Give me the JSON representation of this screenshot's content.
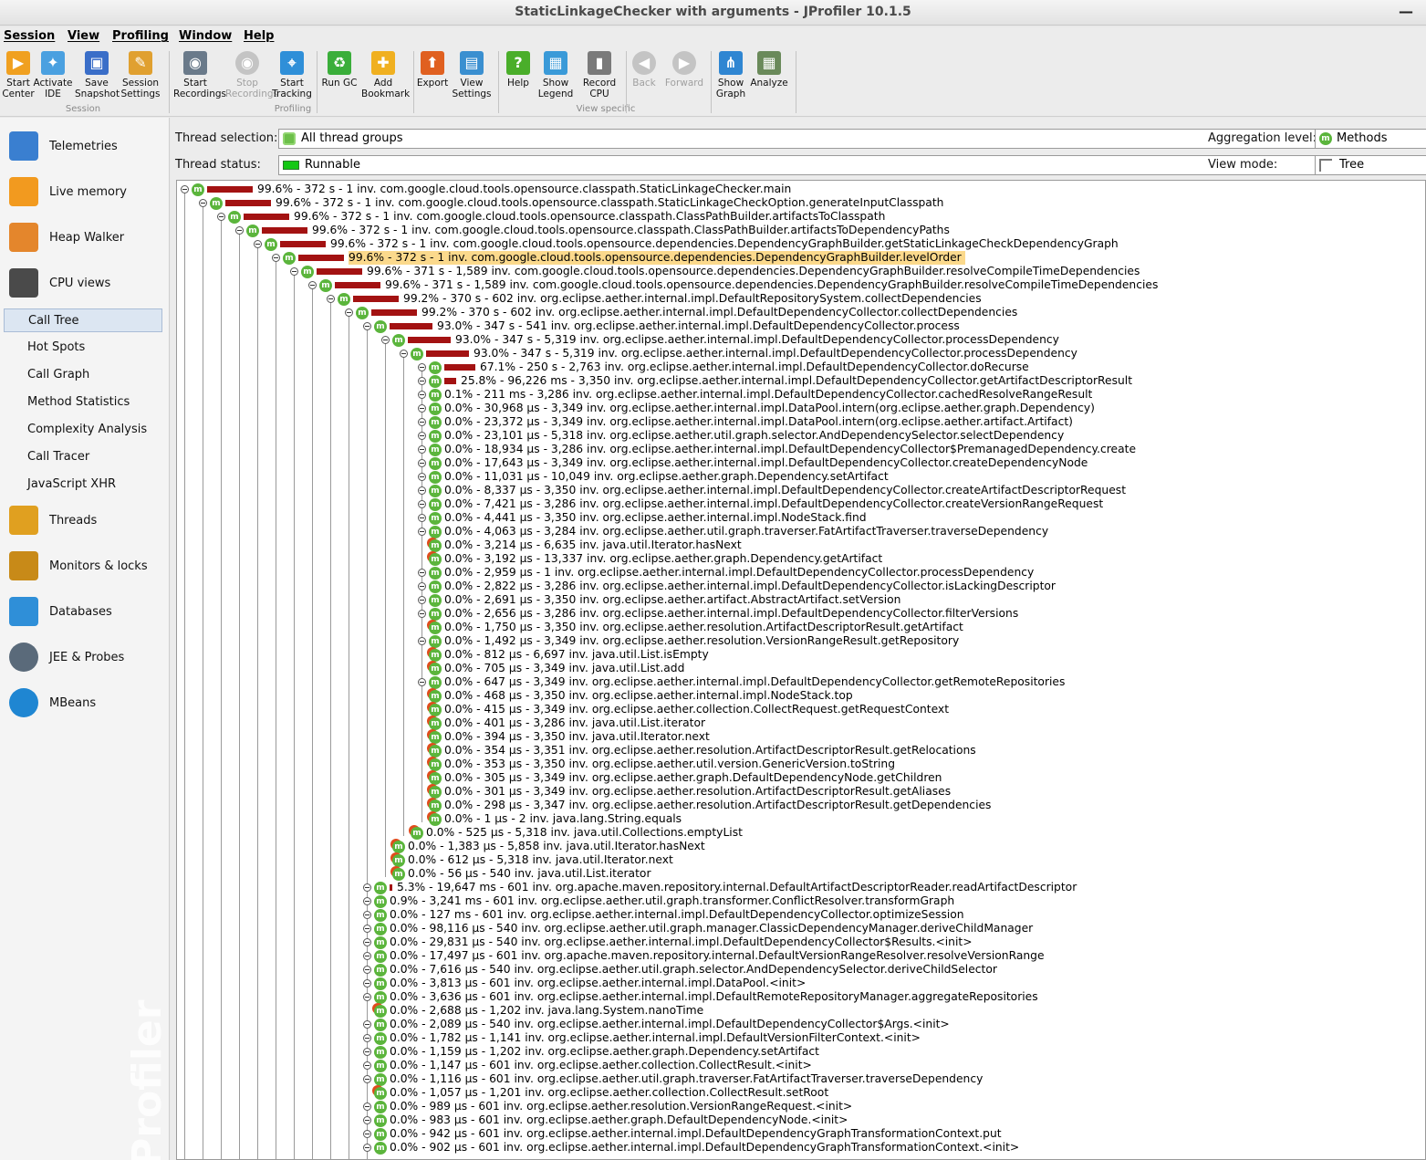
{
  "window": {
    "title": "StaticLinkageChecker with arguments - JProfiler 10.1.5",
    "minimize_glyph": "—"
  },
  "menu": [
    "Session",
    "View",
    "Profiling",
    "Window",
    "Help"
  ],
  "toolbar": {
    "buttons": [
      {
        "label": "Start\nCenter",
        "icon": "start-center-icon",
        "disabled": false
      },
      {
        "label": "Activate\nIDE",
        "icon": "activate-ide-icon",
        "disabled": false
      },
      {
        "label": "Save\nSnapshot",
        "icon": "save-snapshot-icon",
        "disabled": false
      },
      {
        "label": "Session\nSettings",
        "icon": "session-settings-icon",
        "disabled": false
      },
      {
        "label": "Start\nRecordings",
        "icon": "start-recordings-icon",
        "disabled": false
      },
      {
        "label": "Stop\nRecordings",
        "icon": "stop-recordings-icon",
        "disabled": true
      },
      {
        "label": "Start\nTracking",
        "icon": "start-tracking-icon",
        "disabled": false
      },
      {
        "label": "Run GC",
        "icon": "run-gc-icon",
        "disabled": false
      },
      {
        "label": "Add\nBookmark",
        "icon": "add-bookmark-icon",
        "disabled": false
      },
      {
        "label": "Export",
        "icon": "export-icon",
        "disabled": false
      },
      {
        "label": "View\nSettings",
        "icon": "view-settings-icon",
        "disabled": false
      },
      {
        "label": "Help",
        "icon": "help-icon",
        "disabled": false
      },
      {
        "label": "Show\nLegend",
        "icon": "show-legend-icon",
        "disabled": false
      },
      {
        "label": "Record\nCPU",
        "icon": "record-cpu-icon",
        "disabled": false
      },
      {
        "label": "Back",
        "icon": "back-icon",
        "disabled": true
      },
      {
        "label": "Forward",
        "icon": "forward-icon",
        "disabled": true
      },
      {
        "label": "Show\nGraph",
        "icon": "show-graph-icon",
        "disabled": false
      },
      {
        "label": "Analyze",
        "icon": "analyze-icon",
        "disabled": false
      }
    ],
    "groups": [
      "Session",
      "Profiling",
      "View specific"
    ]
  },
  "sidebar": {
    "main_items": [
      {
        "label": "Telemetries",
        "icon": "telemetries-icon",
        "color": "#3a7fd0"
      },
      {
        "label": "Live memory",
        "icon": "live-memory-icon",
        "color": "#f29a1f"
      },
      {
        "label": "Heap Walker",
        "icon": "heap-walker-icon",
        "color": "#e4862c"
      },
      {
        "label": "CPU views",
        "icon": "cpu-views-icon",
        "color": "#4a4a4a"
      },
      {
        "label": "Threads",
        "icon": "threads-icon",
        "color": "#e0a020"
      },
      {
        "label": "Monitors & locks",
        "icon": "monitors-locks-icon",
        "color": "#c88a18"
      },
      {
        "label": "Databases",
        "icon": "databases-icon",
        "color": "#2f8fd8"
      },
      {
        "label": "JEE & Probes",
        "icon": "jee-probes-icon",
        "color": "#5a6a7a"
      },
      {
        "label": "MBeans",
        "icon": "mbeans-icon",
        "color": "#1f86d2"
      }
    ],
    "cpu_sub_items": [
      "Call Tree",
      "Hot Spots",
      "Call Graph",
      "Method Statistics",
      "Complexity Analysis",
      "Call Tracer",
      "JavaScript XHR"
    ],
    "selected_sub": "Call Tree",
    "watermark": "Profiler"
  },
  "filters": {
    "thread_selection_label": "Thread selection:",
    "thread_selection_value": "All thread groups",
    "thread_status_label": "Thread status:",
    "thread_status_value": "Runnable",
    "aggregation_label": "Aggregation level:",
    "aggregation_value": "Methods",
    "view_mode_label": "View mode:",
    "view_mode_value": "Tree"
  },
  "tree_rows": [
    {
      "depth": 0,
      "pct": 99.6,
      "text": "99.6% - 372 s - 1 inv. com.google.cloud.tools.opensource.classpath.StaticLinkageChecker.main",
      "expandable": true
    },
    {
      "depth": 1,
      "pct": 99.6,
      "text": "99.6% - 372 s - 1 inv. com.google.cloud.tools.opensource.classpath.StaticLinkageCheckOption.generateInputClasspath",
      "expandable": true
    },
    {
      "depth": 2,
      "pct": 99.6,
      "text": "99.6% - 372 s - 1 inv. com.google.cloud.tools.opensource.classpath.ClassPathBuilder.artifactsToClasspath",
      "expandable": true
    },
    {
      "depth": 3,
      "pct": 99.6,
      "text": "99.6% - 372 s - 1 inv. com.google.cloud.tools.opensource.classpath.ClassPathBuilder.artifactsToDependencyPaths",
      "expandable": true
    },
    {
      "depth": 4,
      "pct": 99.6,
      "text": "99.6% - 372 s - 1 inv. com.google.cloud.tools.opensource.dependencies.DependencyGraphBuilder.getStaticLinkageCheckDependencyGraph",
      "expandable": true
    },
    {
      "depth": 5,
      "pct": 99.6,
      "text": "99.6% - 372 s - 1 inv. com.google.cloud.tools.opensource.dependencies.DependencyGraphBuilder.levelOrder",
      "expandable": true,
      "selected": true
    },
    {
      "depth": 6,
      "pct": 99.6,
      "text": "99.6% - 371 s - 1,589 inv. com.google.cloud.tools.opensource.dependencies.DependencyGraphBuilder.resolveCompileTimeDependencies",
      "expandable": true
    },
    {
      "depth": 7,
      "pct": 99.6,
      "text": "99.6% - 371 s - 1,589 inv. com.google.cloud.tools.opensource.dependencies.DependencyGraphBuilder.resolveCompileTimeDependencies",
      "expandable": true
    },
    {
      "depth": 8,
      "pct": 99.2,
      "text": "99.2% - 370 s - 602 inv. org.eclipse.aether.internal.impl.DefaultRepositorySystem.collectDependencies",
      "expandable": true
    },
    {
      "depth": 9,
      "pct": 99.2,
      "text": "99.2% - 370 s - 602 inv. org.eclipse.aether.internal.impl.DefaultDependencyCollector.collectDependencies",
      "expandable": true
    },
    {
      "depth": 10,
      "pct": 93.0,
      "text": "93.0% - 347 s - 541 inv. org.eclipse.aether.internal.impl.DefaultDependencyCollector.process",
      "expandable": true
    },
    {
      "depth": 11,
      "pct": 93.0,
      "text": "93.0% - 347 s - 5,319 inv. org.eclipse.aether.internal.impl.DefaultDependencyCollector.processDependency",
      "expandable": true
    },
    {
      "depth": 12,
      "pct": 93.0,
      "text": "93.0% - 347 s - 5,319 inv. org.eclipse.aether.internal.impl.DefaultDependencyCollector.processDependency",
      "expandable": true
    },
    {
      "depth": 13,
      "pct": 67.1,
      "text": "67.1% - 250 s - 2,763 inv. org.eclipse.aether.internal.impl.DefaultDependencyCollector.doRecurse",
      "expandable": true
    },
    {
      "depth": 13,
      "pct": 25.8,
      "text": "25.8% - 96,226 ms - 3,350 inv. org.eclipse.aether.internal.impl.DefaultDependencyCollector.getArtifactDescriptorResult",
      "expandable": true
    },
    {
      "depth": 13,
      "pct": 0.1,
      "text": "0.1% - 211 ms - 3,286 inv. org.eclipse.aether.internal.impl.DefaultDependencyCollector.cachedResolveRangeResult",
      "expandable": true
    },
    {
      "depth": 13,
      "pct": 0.0,
      "text": "0.0% - 30,968 µs - 3,349 inv. org.eclipse.aether.internal.impl.DataPool.intern(org.eclipse.aether.graph.Dependency)",
      "expandable": true
    },
    {
      "depth": 13,
      "pct": 0.0,
      "text": "0.0% - 23,372 µs - 3,349 inv. org.eclipse.aether.internal.impl.DataPool.intern(org.eclipse.aether.artifact.Artifact)",
      "expandable": true
    },
    {
      "depth": 13,
      "pct": 0.0,
      "text": "0.0% - 23,101 µs - 5,318 inv. org.eclipse.aether.util.graph.selector.AndDependencySelector.selectDependency",
      "expandable": true
    },
    {
      "depth": 13,
      "pct": 0.0,
      "text": "0.0% - 18,934 µs - 3,286 inv. org.eclipse.aether.internal.impl.DefaultDependencyCollector$PremanagedDependency.create",
      "expandable": true
    },
    {
      "depth": 13,
      "pct": 0.0,
      "text": "0.0% - 17,643 µs - 3,349 inv. org.eclipse.aether.internal.impl.DefaultDependencyCollector.createDependencyNode",
      "expandable": true
    },
    {
      "depth": 13,
      "pct": 0.0,
      "text": "0.0% - 11,031 µs - 10,049 inv. org.eclipse.aether.graph.Dependency.setArtifact",
      "expandable": true
    },
    {
      "depth": 13,
      "pct": 0.0,
      "text": "0.0% - 8,337 µs - 3,350 inv. org.eclipse.aether.internal.impl.DefaultDependencyCollector.createArtifactDescriptorRequest",
      "expandable": true
    },
    {
      "depth": 13,
      "pct": 0.0,
      "text": "0.0% - 7,421 µs - 3,286 inv. org.eclipse.aether.internal.impl.DefaultDependencyCollector.createVersionRangeRequest",
      "expandable": true
    },
    {
      "depth": 13,
      "pct": 0.0,
      "text": "0.0% - 4,441 µs - 3,350 inv. org.eclipse.aether.internal.impl.NodeStack.find",
      "expandable": true
    },
    {
      "depth": 13,
      "pct": 0.0,
      "text": "0.0% - 4,063 µs - 3,284 inv. org.eclipse.aether.util.graph.traverser.FatArtifactTraverser.traverseDependency",
      "expandable": true
    },
    {
      "depth": 13,
      "pct": 0.0,
      "text": "0.0% - 3,214 µs - 6,635 inv. java.util.Iterator.hasNext",
      "expandable": false
    },
    {
      "depth": 13,
      "pct": 0.0,
      "text": "0.0% - 3,192 µs - 13,337 inv. org.eclipse.aether.graph.Dependency.getArtifact",
      "expandable": false
    },
    {
      "depth": 13,
      "pct": 0.0,
      "text": "0.0% - 2,959 µs - 1 inv. org.eclipse.aether.internal.impl.DefaultDependencyCollector.processDependency",
      "expandable": true
    },
    {
      "depth": 13,
      "pct": 0.0,
      "text": "0.0% - 2,822 µs - 3,286 inv. org.eclipse.aether.internal.impl.DefaultDependencyCollector.isLackingDescriptor",
      "expandable": true
    },
    {
      "depth": 13,
      "pct": 0.0,
      "text": "0.0% - 2,691 µs - 3,350 inv. org.eclipse.aether.artifact.AbstractArtifact.setVersion",
      "expandable": true
    },
    {
      "depth": 13,
      "pct": 0.0,
      "text": "0.0% - 2,656 µs - 3,286 inv. org.eclipse.aether.internal.impl.DefaultDependencyCollector.filterVersions",
      "expandable": true
    },
    {
      "depth": 13,
      "pct": 0.0,
      "text": "0.0% - 1,750 µs - 3,350 inv. org.eclipse.aether.resolution.ArtifactDescriptorResult.getArtifact",
      "expandable": false
    },
    {
      "depth": 13,
      "pct": 0.0,
      "text": "0.0% - 1,492 µs - 3,349 inv. org.eclipse.aether.resolution.VersionRangeResult.getRepository",
      "expandable": true
    },
    {
      "depth": 13,
      "pct": 0.0,
      "text": "0.0% - 812 µs - 6,697 inv. java.util.List.isEmpty",
      "expandable": false
    },
    {
      "depth": 13,
      "pct": 0.0,
      "text": "0.0% - 705 µs - 3,349 inv. java.util.List.add",
      "expandable": false
    },
    {
      "depth": 13,
      "pct": 0.0,
      "text": "0.0% - 647 µs - 3,349 inv. org.eclipse.aether.internal.impl.DefaultDependencyCollector.getRemoteRepositories",
      "expandable": true
    },
    {
      "depth": 13,
      "pct": 0.0,
      "text": "0.0% - 468 µs - 3,350 inv. org.eclipse.aether.internal.impl.NodeStack.top",
      "expandable": false
    },
    {
      "depth": 13,
      "pct": 0.0,
      "text": "0.0% - 415 µs - 3,349 inv. org.eclipse.aether.collection.CollectRequest.getRequestContext",
      "expandable": false
    },
    {
      "depth": 13,
      "pct": 0.0,
      "text": "0.0% - 401 µs - 3,286 inv. java.util.List.iterator",
      "expandable": false
    },
    {
      "depth": 13,
      "pct": 0.0,
      "text": "0.0% - 394 µs - 3,350 inv. java.util.Iterator.next",
      "expandable": false
    },
    {
      "depth": 13,
      "pct": 0.0,
      "text": "0.0% - 354 µs - 3,351 inv. org.eclipse.aether.resolution.ArtifactDescriptorResult.getRelocations",
      "expandable": false
    },
    {
      "depth": 13,
      "pct": 0.0,
      "text": "0.0% - 353 µs - 3,350 inv. org.eclipse.aether.util.version.GenericVersion.toString",
      "expandable": false
    },
    {
      "depth": 13,
      "pct": 0.0,
      "text": "0.0% - 305 µs - 3,349 inv. org.eclipse.aether.graph.DefaultDependencyNode.getChildren",
      "expandable": false
    },
    {
      "depth": 13,
      "pct": 0.0,
      "text": "0.0% - 301 µs - 3,349 inv. org.eclipse.aether.resolution.ArtifactDescriptorResult.getAliases",
      "expandable": false
    },
    {
      "depth": 13,
      "pct": 0.0,
      "text": "0.0% - 298 µs - 3,347 inv. org.eclipse.aether.resolution.ArtifactDescriptorResult.getDependencies",
      "expandable": false
    },
    {
      "depth": 13,
      "pct": 0.0,
      "text": "0.0% - 1 µs - 2 inv. java.lang.String.equals",
      "expandable": false
    },
    {
      "depth": 12,
      "pct": 0.0,
      "text": "0.0% - 525 µs - 5,318 inv. java.util.Collections.emptyList",
      "expandable": false
    },
    {
      "depth": 11,
      "pct": 0.0,
      "text": "0.0% - 1,383 µs - 5,858 inv. java.util.Iterator.hasNext",
      "expandable": false
    },
    {
      "depth": 11,
      "pct": 0.0,
      "text": "0.0% - 612 µs - 5,318 inv. java.util.Iterator.next",
      "expandable": false
    },
    {
      "depth": 11,
      "pct": 0.0,
      "text": "0.0% - 56 µs - 540 inv. java.util.List.iterator",
      "expandable": false
    },
    {
      "depth": 10,
      "pct": 5.3,
      "text": "5.3% - 19,647 ms - 601 inv. org.apache.maven.repository.internal.DefaultArtifactDescriptorReader.readArtifactDescriptor",
      "expandable": true
    },
    {
      "depth": 10,
      "pct": 0.9,
      "text": "0.9% - 3,241 ms - 601 inv. org.eclipse.aether.util.graph.transformer.ConflictResolver.transformGraph",
      "expandable": true
    },
    {
      "depth": 10,
      "pct": 0.0,
      "text": "0.0% - 127 ms - 601 inv. org.eclipse.aether.internal.impl.DefaultDependencyCollector.optimizeSession",
      "expandable": true
    },
    {
      "depth": 10,
      "pct": 0.0,
      "text": "0.0% - 98,116 µs - 540 inv. org.eclipse.aether.util.graph.manager.ClassicDependencyManager.deriveChildManager",
      "expandable": true
    },
    {
      "depth": 10,
      "pct": 0.0,
      "text": "0.0% - 29,831 µs - 540 inv. org.eclipse.aether.internal.impl.DefaultDependencyCollector$Results.<init>",
      "expandable": true
    },
    {
      "depth": 10,
      "pct": 0.0,
      "text": "0.0% - 17,497 µs - 601 inv. org.apache.maven.repository.internal.DefaultVersionRangeResolver.resolveVersionRange",
      "expandable": true
    },
    {
      "depth": 10,
      "pct": 0.0,
      "text": "0.0% - 7,616 µs - 540 inv. org.eclipse.aether.util.graph.selector.AndDependencySelector.deriveChildSelector",
      "expandable": true
    },
    {
      "depth": 10,
      "pct": 0.0,
      "text": "0.0% - 3,813 µs - 601 inv. org.eclipse.aether.internal.impl.DataPool.<init>",
      "expandable": true
    },
    {
      "depth": 10,
      "pct": 0.0,
      "text": "0.0% - 3,636 µs - 601 inv. org.eclipse.aether.internal.impl.DefaultRemoteRepositoryManager.aggregateRepositories",
      "expandable": true
    },
    {
      "depth": 10,
      "pct": 0.0,
      "text": "0.0% - 2,688 µs - 1,202 inv. java.lang.System.nanoTime",
      "expandable": false
    },
    {
      "depth": 10,
      "pct": 0.0,
      "text": "0.0% - 2,089 µs - 540 inv. org.eclipse.aether.internal.impl.DefaultDependencyCollector$Args.<init>",
      "expandable": true
    },
    {
      "depth": 10,
      "pct": 0.0,
      "text": "0.0% - 1,782 µs - 1,141 inv. org.eclipse.aether.internal.impl.DefaultVersionFilterContext.<init>",
      "expandable": true
    },
    {
      "depth": 10,
      "pct": 0.0,
      "text": "0.0% - 1,159 µs - 1,202 inv. org.eclipse.aether.graph.Dependency.setArtifact",
      "expandable": true
    },
    {
      "depth": 10,
      "pct": 0.0,
      "text": "0.0% - 1,147 µs - 601 inv. org.eclipse.aether.collection.CollectResult.<init>",
      "expandable": true
    },
    {
      "depth": 10,
      "pct": 0.0,
      "text": "0.0% - 1,116 µs - 601 inv. org.eclipse.aether.util.graph.traverser.FatArtifactTraverser.traverseDependency",
      "expandable": true
    },
    {
      "depth": 10,
      "pct": 0.0,
      "text": "0.0% - 1,057 µs - 1,201 inv. org.eclipse.aether.collection.CollectResult.setRoot",
      "expandable": false
    },
    {
      "depth": 10,
      "pct": 0.0,
      "text": "0.0% - 989 µs - 601 inv. org.eclipse.aether.resolution.VersionRangeRequest.<init>",
      "expandable": true
    },
    {
      "depth": 10,
      "pct": 0.0,
      "text": "0.0% - 983 µs - 601 inv. org.eclipse.aether.graph.DefaultDependencyNode.<init>",
      "expandable": true
    },
    {
      "depth": 10,
      "pct": 0.0,
      "text": "0.0% - 942 µs - 601 inv. org.eclipse.aether.internal.impl.DefaultDependencyGraphTransformationContext.put",
      "expandable": true
    },
    {
      "depth": 10,
      "pct": 0.0,
      "text": "0.0% - 902 µs - 601 inv. org.eclipse.aether.internal.impl.DefaultDependencyGraphTransformationContext.<init>",
      "expandable": true
    }
  ]
}
